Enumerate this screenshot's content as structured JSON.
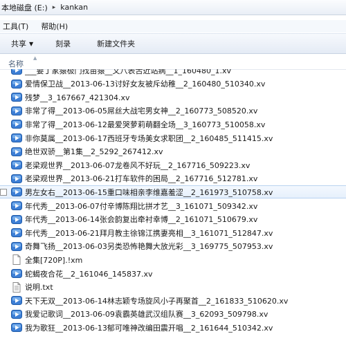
{
  "address": {
    "drive": "本地磁盘 (E:)",
    "separator": "▸",
    "folder": "kankan"
  },
  "menu": {
    "tools": "工具(T)",
    "help": "帮助(H)"
  },
  "toolbar": {
    "share": "共享",
    "share_arrow": "▼",
    "burn": "刻录",
    "new_folder": "新建文件夹"
  },
  "columns": {
    "name": "名称",
    "sort_indicator": "▲"
  },
  "files": [
    {
      "name": "___要丁家猿极门找苗猿__文八表舌近站病__1_160480_1.xv",
      "type": "video"
    },
    {
      "name": "爱情保卫战__2013-06-13讨好女友被斥幼稚__2_160480_510340.xv",
      "type": "video"
    },
    {
      "name": "残梦__3_167667_421304.xv",
      "type": "video"
    },
    {
      "name": "非常了得__2013-06-05屌丝大战宅男女神__2_160773_508520.xv",
      "type": "video"
    },
    {
      "name": "非常了得__2013-06-12最爱哭萝莉萌翻全场__3_160773_510058.xv",
      "type": "video"
    },
    {
      "name": "非你莫属__2013-06-17西班牙专场美女求职团__2_160485_511415.xv",
      "type": "video"
    },
    {
      "name": "绝世双骄__第1集__2_5292_267412.xv",
      "type": "video"
    },
    {
      "name": "老梁观世界__2013-06-07龙卷风不好玩__2_167716_509223.xv",
      "type": "video"
    },
    {
      "name": "老梁观世界__2013-06-21打车软件的困局__2_167716_512781.xv",
      "type": "video"
    },
    {
      "name": "男左女右__2013-06-15重口味相亲李维嘉羞涩__2_161973_510758.xv",
      "type": "video",
      "selected": true
    },
    {
      "name": "年代秀__2013-06-07付辛博陈翔比拼才艺__3_161071_509342.xv",
      "type": "video"
    },
    {
      "name": "年代秀__2013-06-14张会韵复出牵衬幸博__2_161071_510679.xv",
      "type": "video"
    },
    {
      "name": "年代秀__2013-06-21拜月教主徐锦江携妻亮相__3_161071_512847.xv",
      "type": "video"
    },
    {
      "name": "奇舞飞扬__2013-06-03另类恐怖艳舞大放光彩__3_169775_507953.xv",
      "type": "video"
    },
    {
      "name": "全集[720P].!xm",
      "type": "blank"
    },
    {
      "name": "蛇蝎夜合花__2_161046_145837.xv",
      "type": "video"
    },
    {
      "name": "说明.txt",
      "type": "text"
    },
    {
      "name": "天下无双__2013-06-14林志颖专场旋风小子再聚首__2_161833_510620.xv",
      "type": "video"
    },
    {
      "name": "我爱记歌词__2013-06-09袁霸英雄武汉组队赛__3_62093_509798.xv",
      "type": "video"
    },
    {
      "name": "我为歌狂__2013-06-13郁可唯神改编田震开唱__2_161644_510342.xv",
      "type": "video"
    }
  ]
}
